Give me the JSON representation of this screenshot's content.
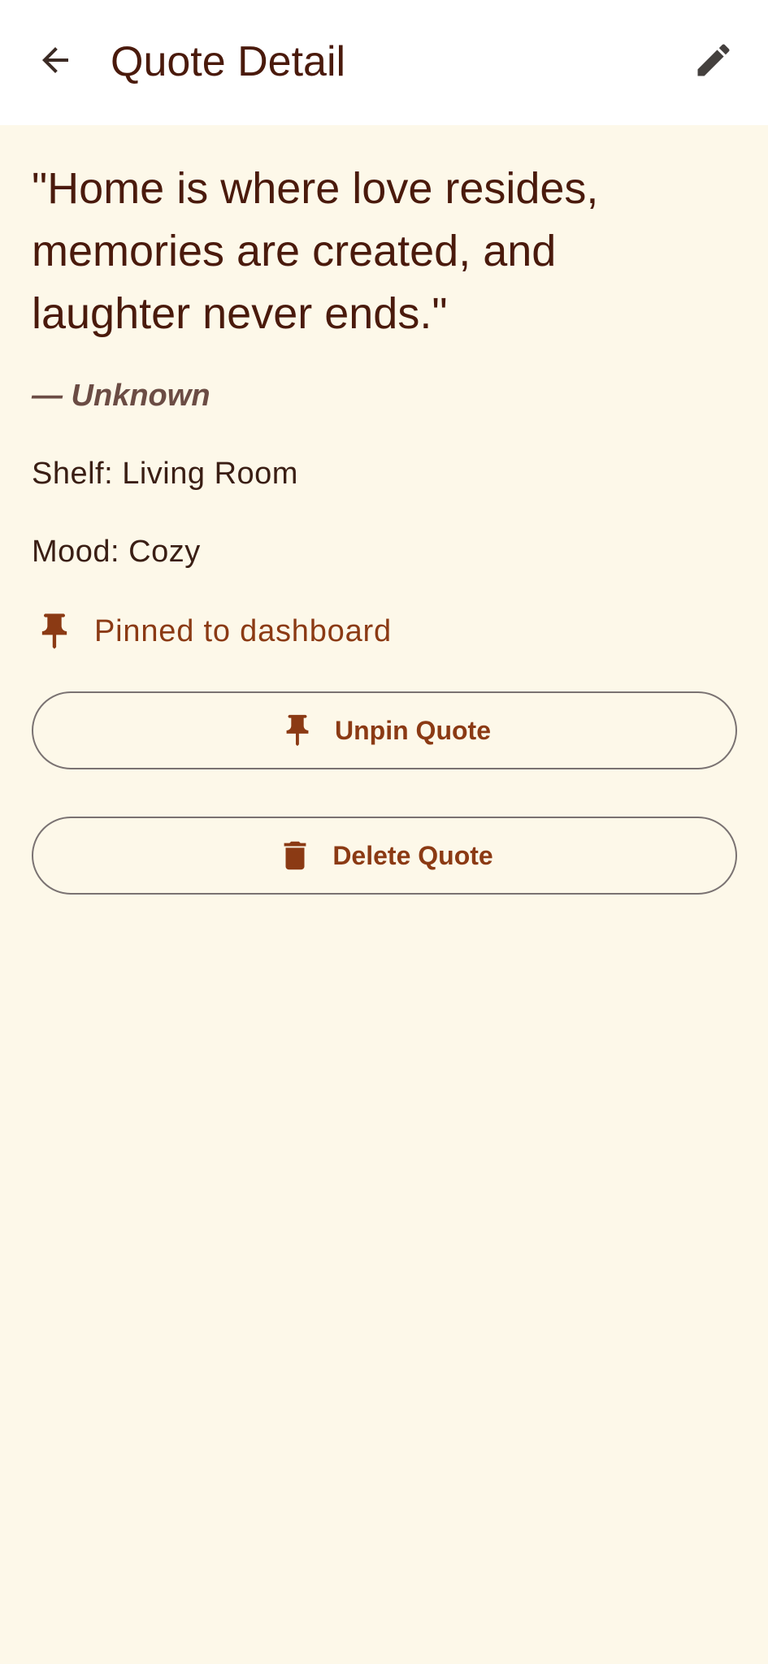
{
  "app_bar": {
    "title": "Quote Detail",
    "back_icon": "arrow-left-icon",
    "edit_icon": "pencil-icon"
  },
  "quote": {
    "text": "\"Home is where love resides, memories are created, and laughter never ends.\"",
    "author": "— Unknown",
    "shelf": "Shelf: Living Room",
    "mood": "Mood: Cozy",
    "pinned_status": "Pinned to dashboard"
  },
  "actions": {
    "unpin_label": "Unpin Quote",
    "delete_label": "Delete Quote"
  },
  "colors": {
    "background": "#FDF8E9",
    "app_bar": "#FFFFFF",
    "primary_text": "#4A1A0C",
    "accent": "#8B3A14",
    "outline": "#7A7272"
  }
}
